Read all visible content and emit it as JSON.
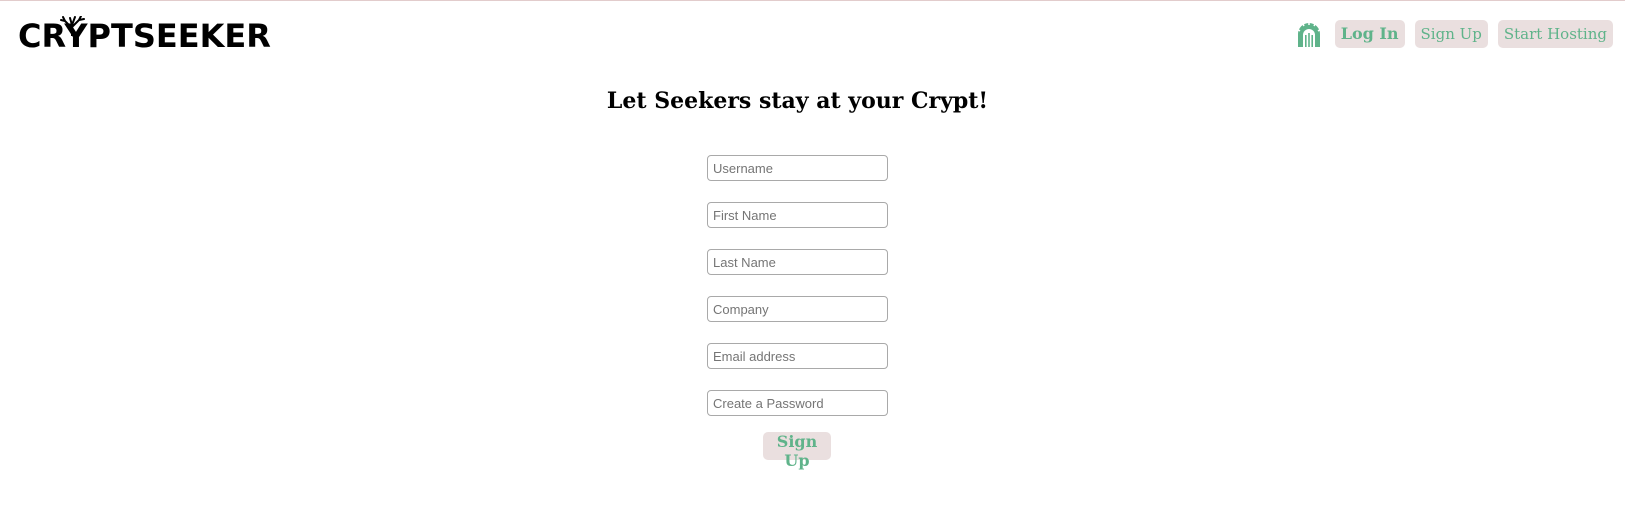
{
  "brand": {
    "logo_text": "CRYPTSEEKER"
  },
  "nav": {
    "icon": "crypt-gate-icon",
    "login_label": "Log In",
    "signup_label": "Sign Up",
    "hosting_label": "Start Hosting"
  },
  "main": {
    "title": "Let Seekers stay at your Crypt!",
    "fields": {
      "username": "Username",
      "first_name": "First Name",
      "last_name": "Last Name",
      "company": "Company",
      "email": "Email address",
      "password": "Create a Password"
    },
    "submit_label": "Sign Up"
  },
  "colors": {
    "accent": "#5fb38a",
    "button_bg": "#eadfdf"
  }
}
